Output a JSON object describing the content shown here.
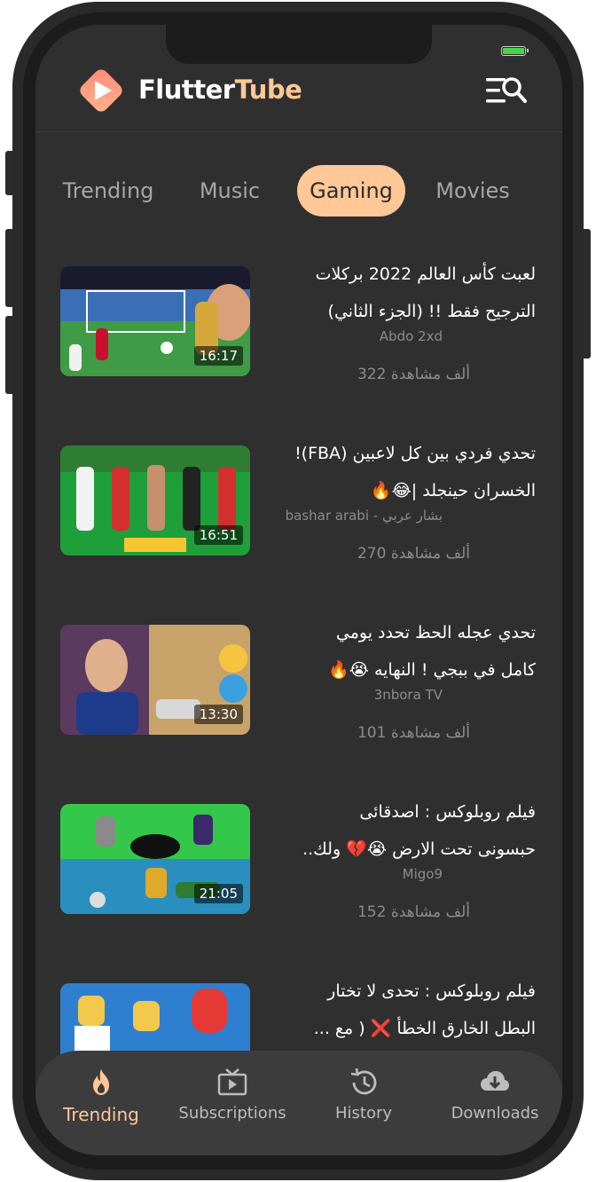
{
  "app": {
    "title_main": "Flutter",
    "title_accent": "Tube"
  },
  "tabs": [
    {
      "label": "Trending",
      "active": false
    },
    {
      "label": "Music",
      "active": false
    },
    {
      "label": "Gaming",
      "active": true
    },
    {
      "label": "Movies",
      "active": false
    }
  ],
  "videos": [
    {
      "title_line1": "لعبت كأس العالم 2022 بركلات",
      "title_line2": "الترجيح فقط !! (الجزء الثاني)",
      "channel": "Abdo 2xd",
      "views": "ألف مشاهدة 322",
      "duration": "16:17"
    },
    {
      "title_line1": "تحدي فردي بين كل لاعبين (FBA)!",
      "title_line2": "الخسران حينجلد |😂🔥",
      "channel": "بشار عربي - bashar arabi",
      "views": "ألف مشاهدة 270",
      "duration": "16:51"
    },
    {
      "title_line1": "تحدي عجله الحظ تحدد يومي",
      "title_line2": "كامل في ببجي ! النهايه 😭🔥",
      "channel": "3nbora TV",
      "views": "ألف مشاهدة 101",
      "duration": "13:30"
    },
    {
      "title_line1": "فيلم روبلوكس : اصدقائى",
      "title_line2": "حبسونى تحت الارض 😭💔 ولك..",
      "channel": "Migo9",
      "views": "ألف مشاهدة 152",
      "duration": "21:05"
    },
    {
      "title_line1": "فيلم روبلوكس : تحدى لا تختار",
      "title_line2": "البطل الخارق الخطأ ❌ ( مع ...",
      "channel": "",
      "views": "",
      "duration": ""
    }
  ],
  "bottom_nav": [
    {
      "label": "Trending",
      "icon": "flame-icon",
      "active": true
    },
    {
      "label": "Subscriptions",
      "icon": "subscriptions-icon",
      "active": false
    },
    {
      "label": "History",
      "icon": "history-icon",
      "active": false
    },
    {
      "label": "Downloads",
      "icon": "cloud-download-icon",
      "active": false
    }
  ],
  "colors": {
    "accent": "#ffc896",
    "background": "#2f2f2f",
    "nav_background": "#3c3c3c",
    "logo_gradient_start": "#ff8a7a",
    "logo_gradient_end": "#ffb38a"
  }
}
